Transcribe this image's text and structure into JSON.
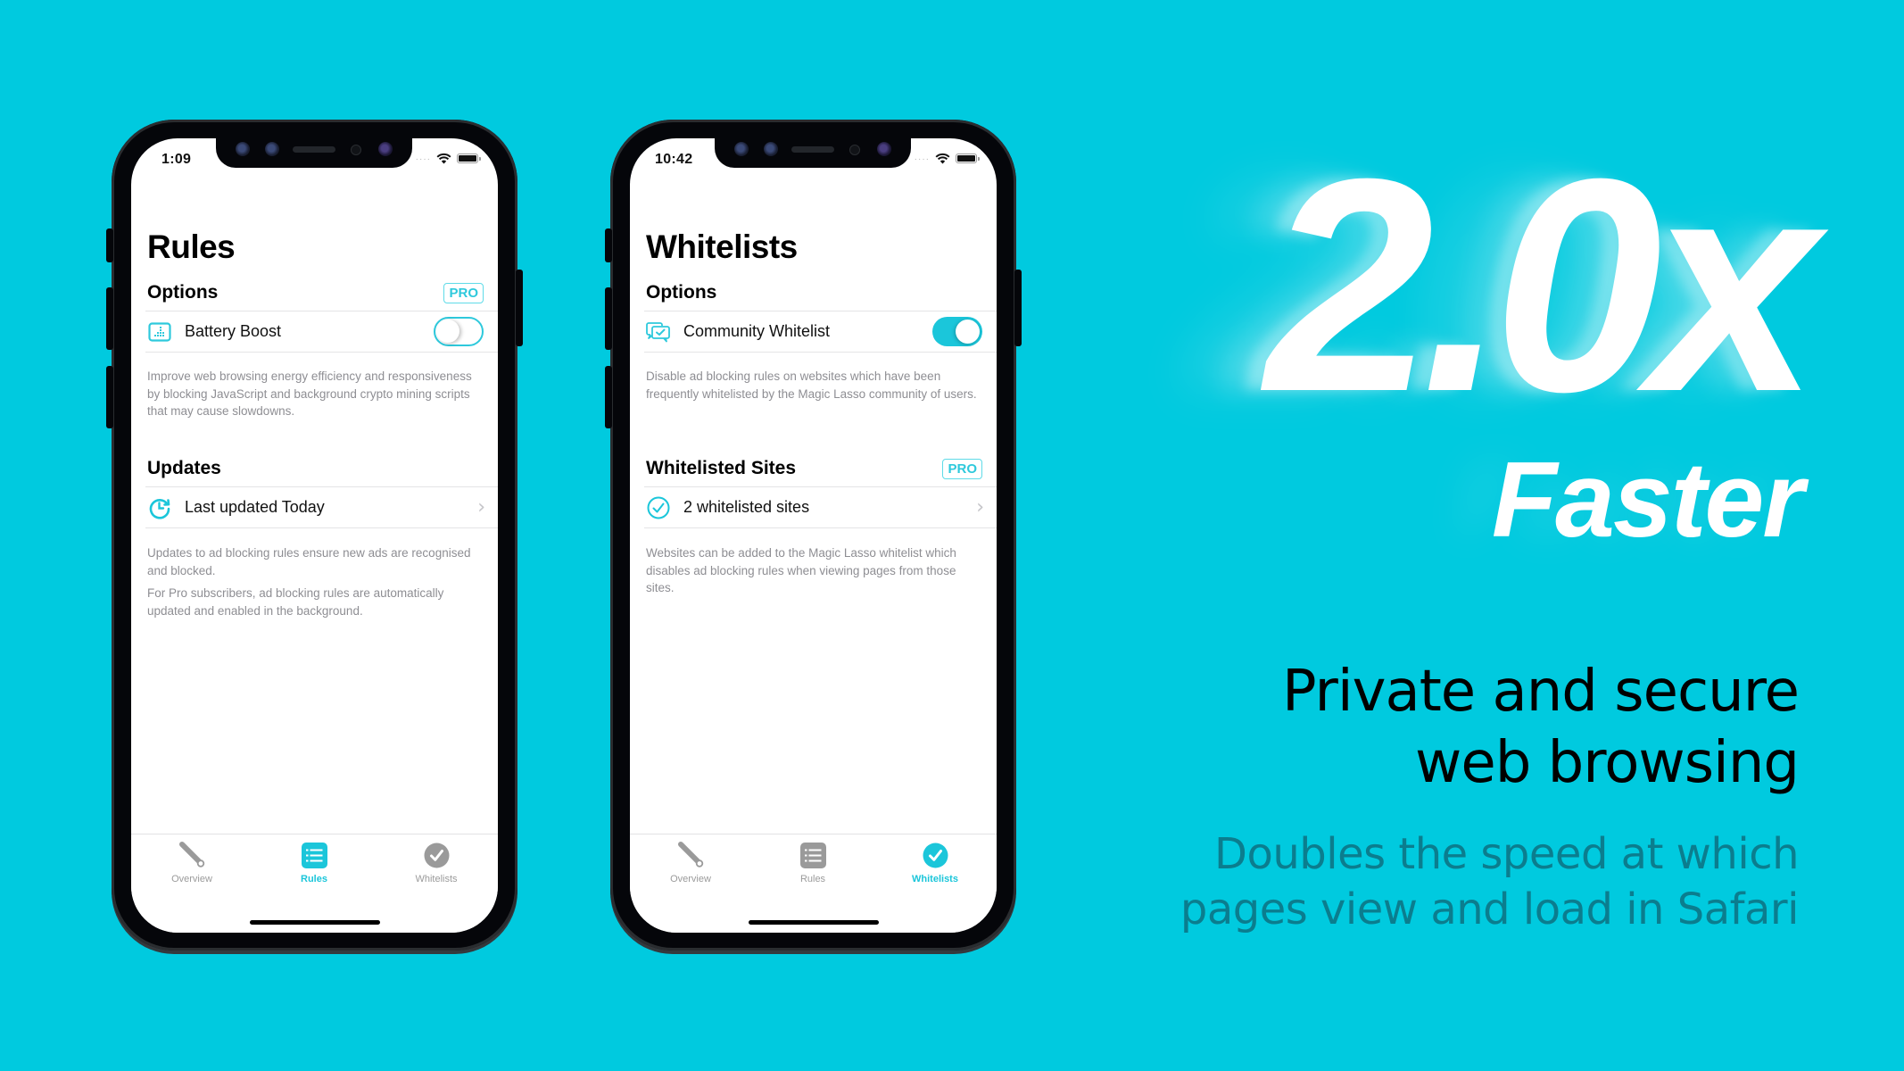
{
  "colors": {
    "background": "#00cadf",
    "accent": "#1bc6da",
    "subtext": "#0b7d8e"
  },
  "phones": [
    {
      "status": {
        "time": "1:09",
        "signal": "····"
      },
      "title": "Rules",
      "sections": {
        "options": {
          "label": "Options",
          "badge": "PRO"
        },
        "options_row": {
          "icon": "battery-boost-icon",
          "label": "Battery Boost",
          "toggle": "off"
        },
        "options_footnote": "Improve web browsing energy efficiency and responsiveness by blocking JavaScript and background crypto mining scripts that may cause slowdowns.",
        "second": {
          "label": "Updates"
        },
        "second_row": {
          "icon": "refresh-clock-icon",
          "label": "Last updated Today"
        },
        "second_footnotes": [
          "Updates to ad blocking rules ensure new ads are recognised and blocked.",
          "For Pro subscribers, ad blocking rules are automatically updated and enabled in the background."
        ]
      },
      "tabs": [
        {
          "label": "Overview",
          "icon": "lasso-wand-icon",
          "active": false
        },
        {
          "label": "Rules",
          "icon": "list-icon",
          "active": true
        },
        {
          "label": "Whitelists",
          "icon": "checkmark-circle-icon",
          "active": false
        }
      ]
    },
    {
      "status": {
        "time": "10:42",
        "signal": "····"
      },
      "title": "Whitelists",
      "sections": {
        "options": {
          "label": "Options"
        },
        "options_row": {
          "icon": "community-chat-check-icon",
          "label": "Community Whitelist",
          "toggle": "on"
        },
        "options_footnote": "Disable ad blocking rules on websites which have been frequently whitelisted by the Magic Lasso community of users.",
        "second": {
          "label": "Whitelisted Sites",
          "badge": "PRO"
        },
        "second_row": {
          "icon": "checkmark-circle-outline-icon",
          "label": "2 whitelisted sites"
        },
        "second_footnotes": [
          "Websites can be added to the Magic Lasso whitelist which disables ad blocking rules when viewing pages from those sites."
        ]
      },
      "tabs": [
        {
          "label": "Overview",
          "icon": "lasso-wand-icon",
          "active": false
        },
        {
          "label": "Rules",
          "icon": "list-icon",
          "active": false
        },
        {
          "label": "Whitelists",
          "icon": "checkmark-circle-icon",
          "active": true
        }
      ]
    }
  ],
  "hero": {
    "speed": "2.0x",
    "speed_word": "Faster",
    "headline_lines": [
      "Private and secure",
      "web browsing"
    ],
    "subline_lines": [
      "Doubles the speed at which",
      "pages view and load in Safari"
    ]
  }
}
